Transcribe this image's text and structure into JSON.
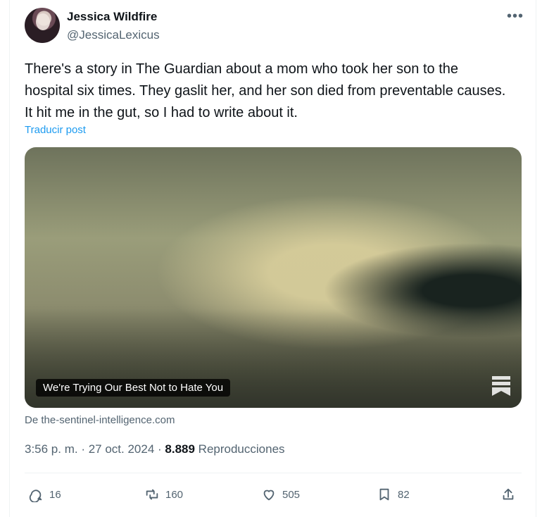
{
  "post": {
    "name": "Jessica Wildfire",
    "handle": "@JessicaLexicus",
    "text": "There's a story in The Guardian about a mom who took her son to the hospital six times. They gaslit her, and her son died from preventable causes. It hit me in the gut, so I had to write about it.",
    "translate_label": "Traducir post",
    "media": {
      "title": "We're Trying Our Best Not to Hate You"
    },
    "source_text": "De the-sentinel-intelligence.com",
    "timestamp": "3:56 p. m. · 27 oct. 2024 · ",
    "views": "8.889",
    "views_label": " Reproducciones"
  },
  "actions": {
    "replies": "16",
    "reposts": "160",
    "likes": "505",
    "bookmarks": "82"
  },
  "icons": {
    "more": "more-horizontal-icon",
    "reply": "reply-icon",
    "repost": "repost-icon",
    "like": "heart-icon",
    "bookmark": "bookmark-icon",
    "share": "share-icon",
    "media_badge": "bookmark-badge-icon"
  },
  "colors": {
    "accent": "#1d9bf0",
    "text": "#0f1419",
    "muted": "#536471"
  }
}
